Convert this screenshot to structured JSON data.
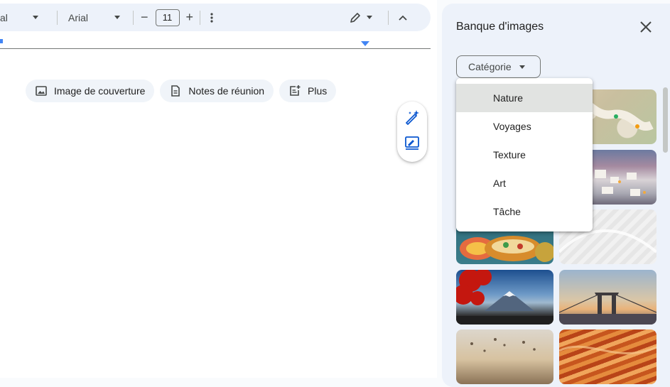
{
  "toolbar": {
    "style_value": "al",
    "font_value": "Arial",
    "font_size": "11",
    "decrease_label": "−",
    "increase_label": "+"
  },
  "chips": [
    {
      "label": "Image de couverture",
      "icon": "image-icon"
    },
    {
      "label": "Notes de réunion",
      "icon": "document-icon"
    },
    {
      "label": "Plus",
      "icon": "add-note-icon"
    }
  ],
  "side_buttons": {
    "icons": [
      "magic-pen-icon",
      "signature-edit-icon"
    ]
  },
  "panel": {
    "title": "Banque d'images",
    "category_label": "Catégorie",
    "close_icon": "close-icon"
  },
  "dropdown": {
    "selected": "Nature",
    "options": [
      "Nature",
      "Voyages",
      "Texture",
      "Art",
      "Tâche"
    ]
  },
  "images": [
    {
      "name": "colorful-candy-path"
    },
    {
      "name": "coastal-town"
    },
    {
      "name": "tacos-platter"
    },
    {
      "name": "white-wave-texture"
    },
    {
      "name": "mount-fuji-red-tree"
    },
    {
      "name": "bridge-sunset"
    },
    {
      "name": "hot-air-balloons"
    },
    {
      "name": "sandstone-waves"
    }
  ],
  "colors": {
    "toolbar_bg": "#edf2fa",
    "accent": "#4285f4",
    "panel_bg": "#edf2fa"
  }
}
